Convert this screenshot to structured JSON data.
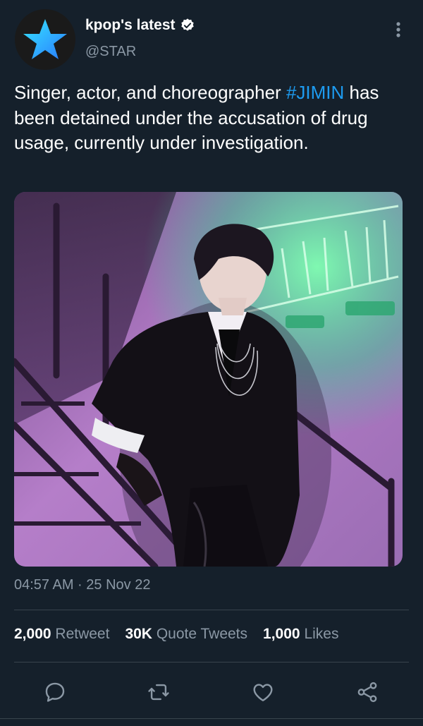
{
  "author": {
    "display_name": "kpop's latest",
    "handle": "@STAR",
    "verified_icon": "verified-badge-icon",
    "avatar_icon": "star-icon"
  },
  "tweet": {
    "text_before": "Singer, actor, and choreographer ",
    "hashtag": "#JIMIN",
    "text_after": " has been detained under the accusation of drug usage, currently under investigation.",
    "timestamp": "04:57 AM · 25 Nov 22"
  },
  "stats": {
    "retweets_count": "2,000",
    "retweets_label": "Retweet",
    "quotes_count": "30K",
    "quotes_label": "Quote Tweets",
    "likes_count": "1,000",
    "likes_label": "Likes"
  },
  "actions": [
    "reply-icon",
    "retweet-icon",
    "like-icon",
    "share-icon"
  ],
  "colors": {
    "background": "#15202b",
    "accent": "#1d9bf0",
    "secondary_text": "#8b98a5",
    "divider": "#38444d"
  }
}
